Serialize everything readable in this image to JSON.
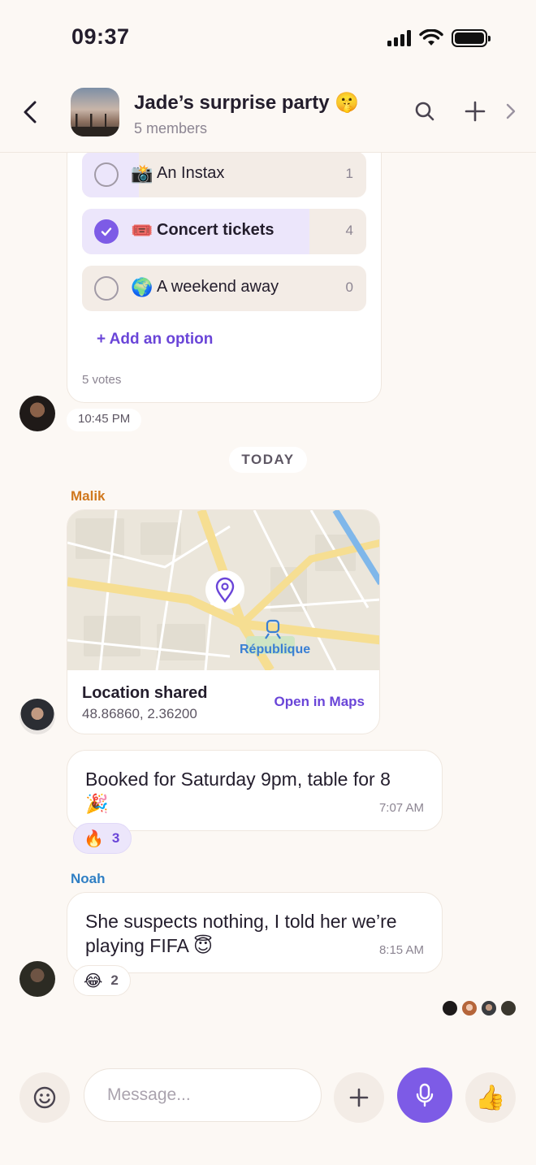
{
  "status_bar": {
    "time": "09:37"
  },
  "header": {
    "title": "Jade’s surprise party 🤫",
    "subtitle": "5 members",
    "icons": [
      "chevron-left-icon",
      "search-icon",
      "plus-icon",
      "chevron-right-icon"
    ]
  },
  "poll": {
    "options": [
      {
        "emoji": "📸",
        "label": "An Instax",
        "count": "1",
        "selected": false,
        "share": 0.2
      },
      {
        "emoji": "🎟️",
        "label": "Concert tickets",
        "count": "4",
        "selected": true,
        "share": 0.8
      },
      {
        "emoji": "🌍",
        "label": "A weekend away",
        "count": "0",
        "selected": false,
        "share": 0
      }
    ],
    "add_option": "+ Add an option",
    "votes": "5 votes",
    "time": "10:45 PM"
  },
  "day_divider": "TODAY",
  "location_message": {
    "sender": "Malik",
    "sender_color": "#d0781e",
    "map_label": "République",
    "title": "Location shared",
    "coords": "48.86860, 2.36200",
    "action": "Open in Maps"
  },
  "message_1": {
    "text": "Booked for Saturday 9pm, table for 8 🎉",
    "time": "7:07 AM",
    "reaction": {
      "emoji": "🔥",
      "count": "3"
    }
  },
  "message_2": {
    "sender": "Noah",
    "sender_color": "#2f7fc4",
    "text": "She suspects nothing, I told her we’re playing FIFA 😇",
    "time": "8:15 AM",
    "reaction": {
      "emoji": "😂",
      "count": "2"
    }
  },
  "composer": {
    "placeholder": "Message...",
    "like_emoji": "👍"
  },
  "colors": {
    "accent": "#7d5be6",
    "background": "#fcf8f4"
  }
}
